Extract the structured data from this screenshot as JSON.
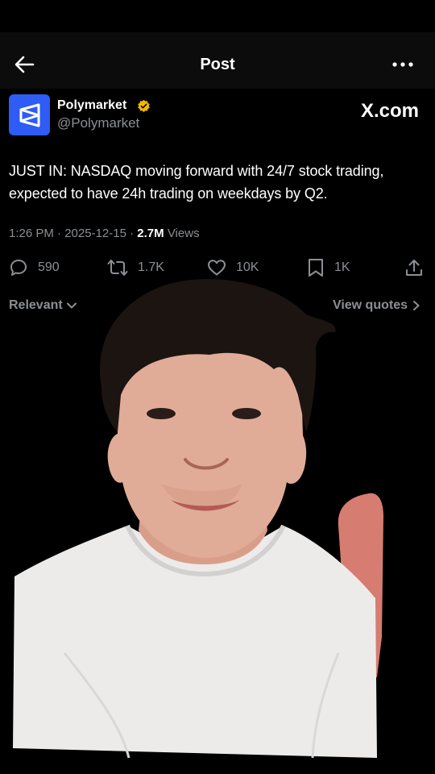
{
  "header": {
    "title": "Post",
    "back_icon": "arrow-left-icon",
    "more_icon": "ellipsis-icon"
  },
  "author": {
    "name": "Polymarket",
    "handle": "@Polymarket",
    "avatar_icon": "polymarket-logo",
    "verified_icon": "verified-badge-icon",
    "verified_color": "#f5b800",
    "avatar_color": "#2e5cf5"
  },
  "watermark": "X.com",
  "post": {
    "text": "JUST IN: NASDAQ moving forward with 24/7 stock trading, expected to have 24h trading on weekdays by Q2.",
    "time": "1:26 PM",
    "date": "2025-12-15",
    "separator": "·",
    "views": "2.7M",
    "views_label": "Views"
  },
  "actions": {
    "replies": "590",
    "reposts": "1.7K",
    "likes": "10K",
    "bookmarks": "1K"
  },
  "replies_bar": {
    "sort_label": "Relevant",
    "view_quotes_label": "View quotes"
  }
}
